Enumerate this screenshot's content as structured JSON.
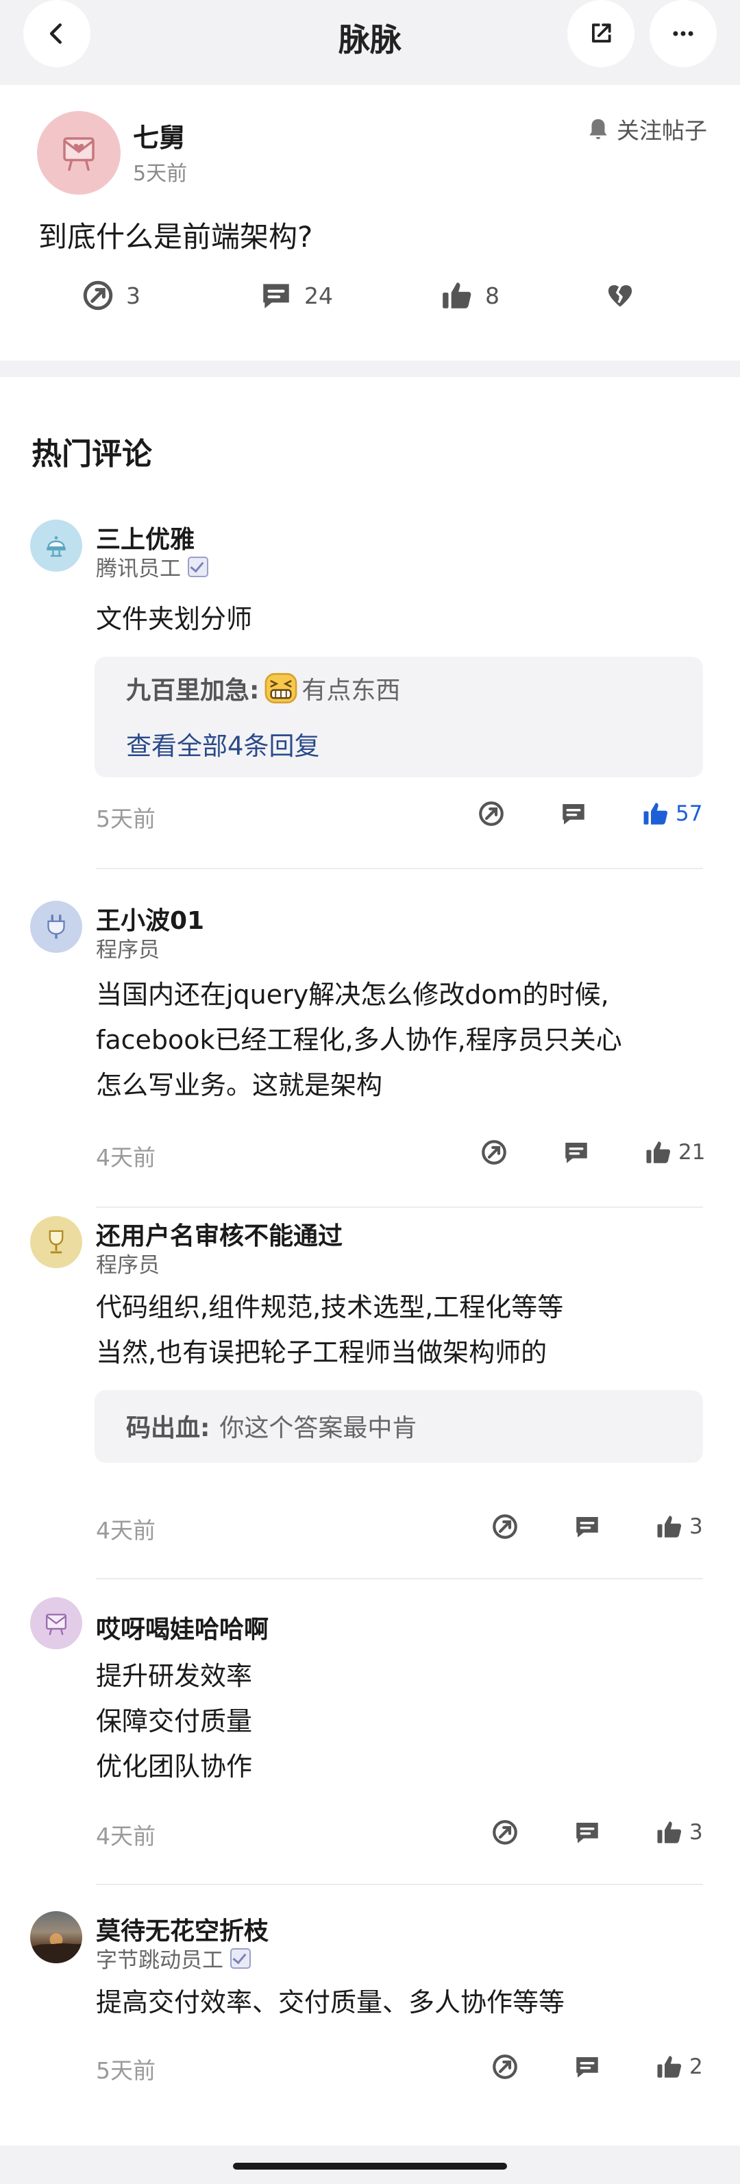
{
  "header": {
    "title": "脉脉"
  },
  "post": {
    "author": "七舅",
    "time": "5天前",
    "follow_label": "关注帖子",
    "title": "到底什么是前端架构?",
    "share_count": "3",
    "comment_count": "24",
    "like_count": "8"
  },
  "comments_section": {
    "title": "热门评论"
  },
  "comments": [
    {
      "name": "三上优雅",
      "role": "腾讯员工",
      "text": "文件夹划分师",
      "reply": {
        "author": "九百里加急:",
        "text": "有点东西"
      },
      "view_all": "查看全部4条回复",
      "time": "5天前",
      "likes": "57"
    },
    {
      "name": "王小波01",
      "role": "程序员",
      "text": "当国内还在jquery解决怎么修改dom的时候,\nfacebook已经工程化,多人协作,程序员只关心\n怎么写业务。这就是架构",
      "time": "4天前",
      "likes": "21"
    },
    {
      "name": "还用户名审核不能通过",
      "role": "程序员",
      "text": "代码组织,组件规范,技术选型,工程化等等\n当然,也有误把轮子工程师当做架构师的",
      "reply": {
        "author": "码出血:",
        "text": "你这个答案最中肯"
      },
      "time": "4天前",
      "likes": "3"
    },
    {
      "name": "哎呀喝娃哈哈啊",
      "text": "提升研发效率\n保障交付质量\n优化团队协作",
      "time": "4天前",
      "likes": "3"
    },
    {
      "name": "莫待无花空折枝",
      "role": "字节跳动员工",
      "text": "提高交付效率、交付质量、多人协作等等",
      "time": "5天前",
      "likes": "2"
    }
  ],
  "colors": {
    "accent_blue": "#1d5fd6",
    "link_blue": "#2a4a8a",
    "muted_gray": "#9a9a9a"
  },
  "icons": [
    "back-icon",
    "share-icon",
    "more-icon",
    "bell-icon",
    "forward-icon",
    "comment-icon",
    "thumbs-up-icon",
    "broken-heart-icon",
    "verified-badge-icon"
  ]
}
